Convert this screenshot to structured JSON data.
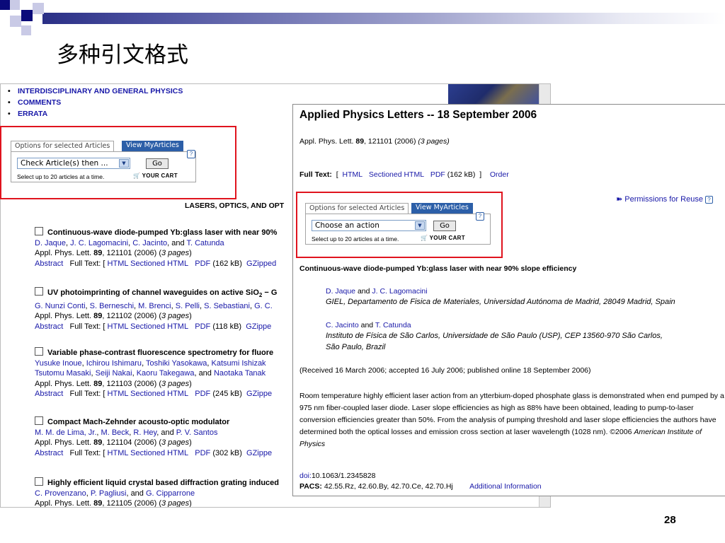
{
  "slide": {
    "title": "多种引文格式",
    "page_number": "28"
  },
  "toc": {
    "nav": [
      "INTERDISCIPLINARY AND GENERAL PHYSICS",
      "COMMENTS",
      "ERRATA"
    ],
    "section_heading": "LASERS, OPTICS, AND OPT",
    "options": {
      "tab_label": "Options for selected Articles",
      "tab_myarticles": "View MyArticles",
      "select_value": "Check Article(s) then ...",
      "go_label": "Go",
      "help": "?",
      "hint": "Select up to 20 articles at a time.",
      "cart": "YOUR CART"
    },
    "articles": [
      {
        "title": "Continuous-wave diode-pumped Yb:glass laser with near 90%",
        "authors": [
          {
            "name": "D. Jaque",
            "sep": ", "
          },
          {
            "name": "J. C. Lagomacini",
            "sep": ", "
          },
          {
            "name": "C. Jacinto",
            "sep": ", and "
          },
          {
            "name": "T. Catunda",
            "sep": ""
          }
        ],
        "journal": "Appl. Phys. Lett.",
        "volume": "89",
        "citation": ", 121101 (2006) (",
        "pages": "3 pages",
        "close": ")",
        "abstract": "Abstract",
        "full_text": "Full Text: [",
        "html": "HTML",
        "sectioned": "Sectioned HTML",
        "pdf": "PDF",
        "size": "(162 kB)",
        "gz": "GZipped"
      },
      {
        "title_pre": "UV photoimprinting of channel waveguides on active SiO",
        "title_sub": "2",
        "title_post": " − G",
        "authors": [
          {
            "name": "G. Nunzi Conti",
            "sep": ", "
          },
          {
            "name": "S. Berneschi",
            "sep": ", "
          },
          {
            "name": "M. Brenci",
            "sep": ", "
          },
          {
            "name": "S. Pelli",
            "sep": ", "
          },
          {
            "name": "S. Sebastiani",
            "sep": ", "
          },
          {
            "name": "G. C.",
            "sep": ""
          }
        ],
        "journal": "Appl. Phys. Lett.",
        "volume": "89",
        "citation": ", 121102 (2006) (",
        "pages": "3 pages",
        "close": ")",
        "abstract": "Abstract",
        "full_text": "Full Text: [",
        "html": "HTML",
        "sectioned": "Sectioned HTML",
        "pdf": "PDF",
        "size": "(118 kB)",
        "gz": "GZippe"
      },
      {
        "title": "Variable phase-contrast fluorescence spectrometry for fluore",
        "authors": [
          {
            "name": "Yusuke Inoue",
            "sep": ", "
          },
          {
            "name": "Ichirou Ishimaru",
            "sep": ", "
          },
          {
            "name": "Toshiki Yasokawa",
            "sep": ", "
          },
          {
            "name": "Katsumi Ishizak",
            "sep": ""
          }
        ],
        "authors2": [
          {
            "name": "Tsutomu Masaki",
            "sep": ", "
          },
          {
            "name": "Seiji Nakai",
            "sep": ", "
          },
          {
            "name": "Kaoru Takegawa",
            "sep": ", and "
          },
          {
            "name": "Naotaka Tanak",
            "sep": ""
          }
        ],
        "journal": "Appl. Phys. Lett.",
        "volume": "89",
        "citation": ", 121103 (2006) (",
        "pages": "3 pages",
        "close": ")",
        "abstract": "Abstract",
        "full_text": "Full Text: [",
        "html": "HTML",
        "sectioned": "Sectioned HTML",
        "pdf": "PDF",
        "size": "(245 kB)",
        "gz": "GZippe"
      },
      {
        "title": "Compact Mach-Zehnder acousto-optic modulator",
        "authors": [
          {
            "name": "M. M. de Lima, Jr.",
            "sep": ", "
          },
          {
            "name": "M. Beck",
            "sep": ", "
          },
          {
            "name": "R. Hey",
            "sep": ", and "
          },
          {
            "name": "P. V. Santos",
            "sep": ""
          }
        ],
        "journal": "Appl. Phys. Lett.",
        "volume": "89",
        "citation": ", 121104 (2006) (",
        "pages": "3 pages",
        "close": ")",
        "abstract": "Abstract",
        "full_text": "Full Text: [",
        "html": "HTML",
        "sectioned": "Sectioned HTML",
        "pdf": "PDF",
        "size": "(302 kB)",
        "gz": "GZippe"
      },
      {
        "title": "Highly efficient liquid crystal based diffraction grating induced",
        "authors": [
          {
            "name": "C. Provenzano",
            "sep": ", "
          },
          {
            "name": "P. Pagliusi",
            "sep": ", and "
          },
          {
            "name": "G. Cipparrone",
            "sep": ""
          }
        ],
        "journal": "Appl. Phys. Lett.",
        "volume": "89",
        "citation": ", 121105 (2006) (",
        "pages": "3 pages",
        "close": ")"
      }
    ]
  },
  "detail": {
    "title": "Applied Physics Letters -- 18 September 2006",
    "citation": {
      "journal": "Appl. Phys. Lett.",
      "volume": "89",
      "rest": ", 121101 (2006) ",
      "pages": "(3 pages)"
    },
    "fulltext": {
      "label": "Full Text:",
      "open": "[",
      "html": "HTML",
      "sectioned": "Sectioned HTML",
      "pdf": "PDF",
      "size": "(162 kB)",
      "close": "]",
      "order": "Order"
    },
    "permissions": "Permissions for Reuse",
    "options": {
      "tab_label": "Options for selected Articles",
      "tab_myarticles": "View MyArticles",
      "select_value": "Choose an action",
      "go_label": "Go",
      "help": "?",
      "hint": "Select up to 20 articles at a time.",
      "cart": "YOUR CART"
    },
    "article_title": "Continuous-wave diode-pumped Yb:glass laser with near 90% slope efficiency",
    "aff1_authors": [
      {
        "name": "D. Jaque",
        "sep": " and "
      },
      {
        "name": "J. C. Lagomacini",
        "sep": ""
      }
    ],
    "aff1_text": "GIEL, Departamento de Fisica de Materiales, Universidad Autónoma de Madrid, 28049 Madrid, Spain",
    "aff2_authors": [
      {
        "name": "C. Jacinto",
        "sep": " and "
      },
      {
        "name": "T. Catunda",
        "sep": ""
      }
    ],
    "aff2_line1": "Instituto de Física de São Carlos, Universidade de São Paulo (USP), CEP 13560-970 São Carlos,",
    "aff2_line2": "São Paulo, Brazil",
    "received": "(Received 16 March 2006; accepted 16 July 2006; published online 18 September 2006)",
    "abstract_body": "Room temperature highly efficient laser action from an ytterbium-doped phosphate glass is demonstrated when end pumped by a 975  nm fiber-coupled laser diode. Laser slope efficiencies as high as 88% have been obtained, leading to pump-to-laser conversion efficiencies greater than 50%. From the analysis of pumping threshold and laser slope efficiencies the authors have determined both the optical losses and emission cross section at laser wavelength (1028  nm). ©2006 ",
    "copyright_holder": "American Institute of Physics",
    "doi_label": "doi:",
    "doi": "10.1063/1.2345828",
    "pacs_label": "PACS:",
    "pacs": "42.55.Rz, 42.60.By, 42.70.Ce, 42.70.Hj",
    "additional": "Additional Information"
  }
}
